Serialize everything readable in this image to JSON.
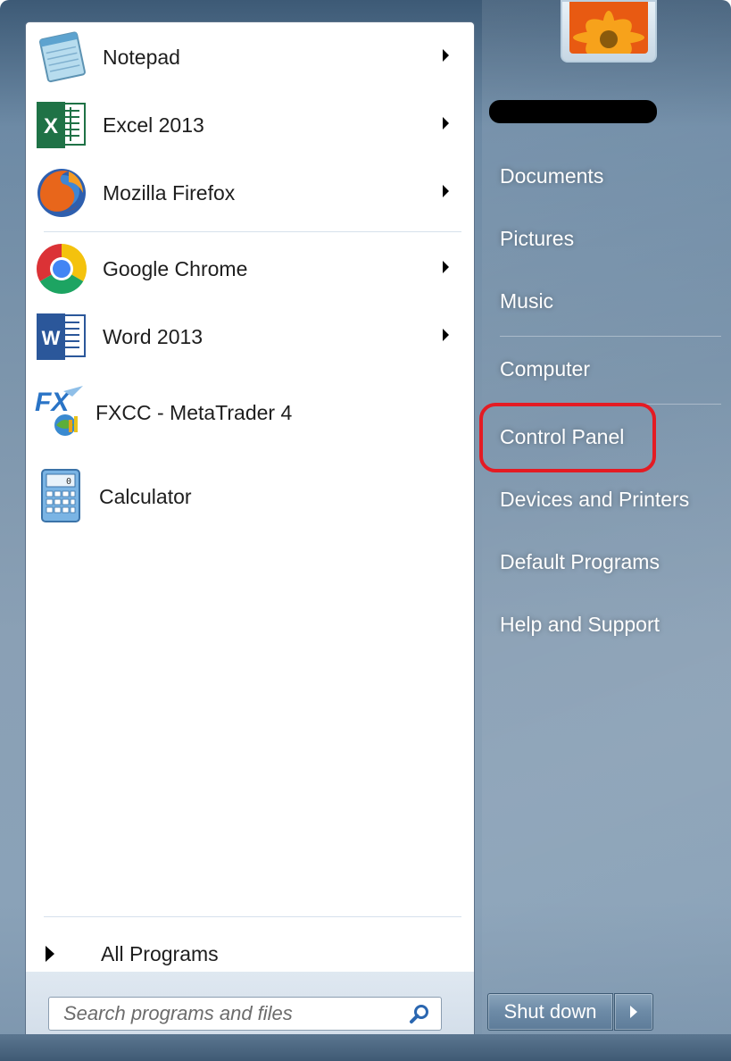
{
  "programs": [
    {
      "label": "Notepad",
      "icon": "notepad-icon",
      "has_submenu": true
    },
    {
      "label": "Excel 2013",
      "icon": "excel-icon",
      "has_submenu": true
    },
    {
      "label": "Mozilla Firefox",
      "icon": "firefox-icon",
      "has_submenu": true
    },
    {
      "label": "Google Chrome",
      "icon": "chrome-icon",
      "has_submenu": true
    },
    {
      "label": "Word 2013",
      "icon": "word-icon",
      "has_submenu": true
    },
    {
      "label": "FXCC - MetaTrader 4",
      "icon": "metatrader-icon",
      "has_submenu": false
    },
    {
      "label": "Calculator",
      "icon": "calculator-icon",
      "has_submenu": false
    }
  ],
  "all_programs_label": "All Programs",
  "search": {
    "placeholder": "Search programs and files"
  },
  "right_items": [
    {
      "label": "Documents"
    },
    {
      "label": "Pictures"
    },
    {
      "label": "Music"
    },
    {
      "label": "Computer"
    },
    {
      "label": "Control Panel"
    },
    {
      "label": "Devices and Printers"
    },
    {
      "label": "Default Programs"
    },
    {
      "label": "Help and Support"
    }
  ],
  "shutdown_label": "Shut down",
  "colors": {
    "highlight_ring": "#e41b23",
    "accent": "#6d8aa5"
  }
}
